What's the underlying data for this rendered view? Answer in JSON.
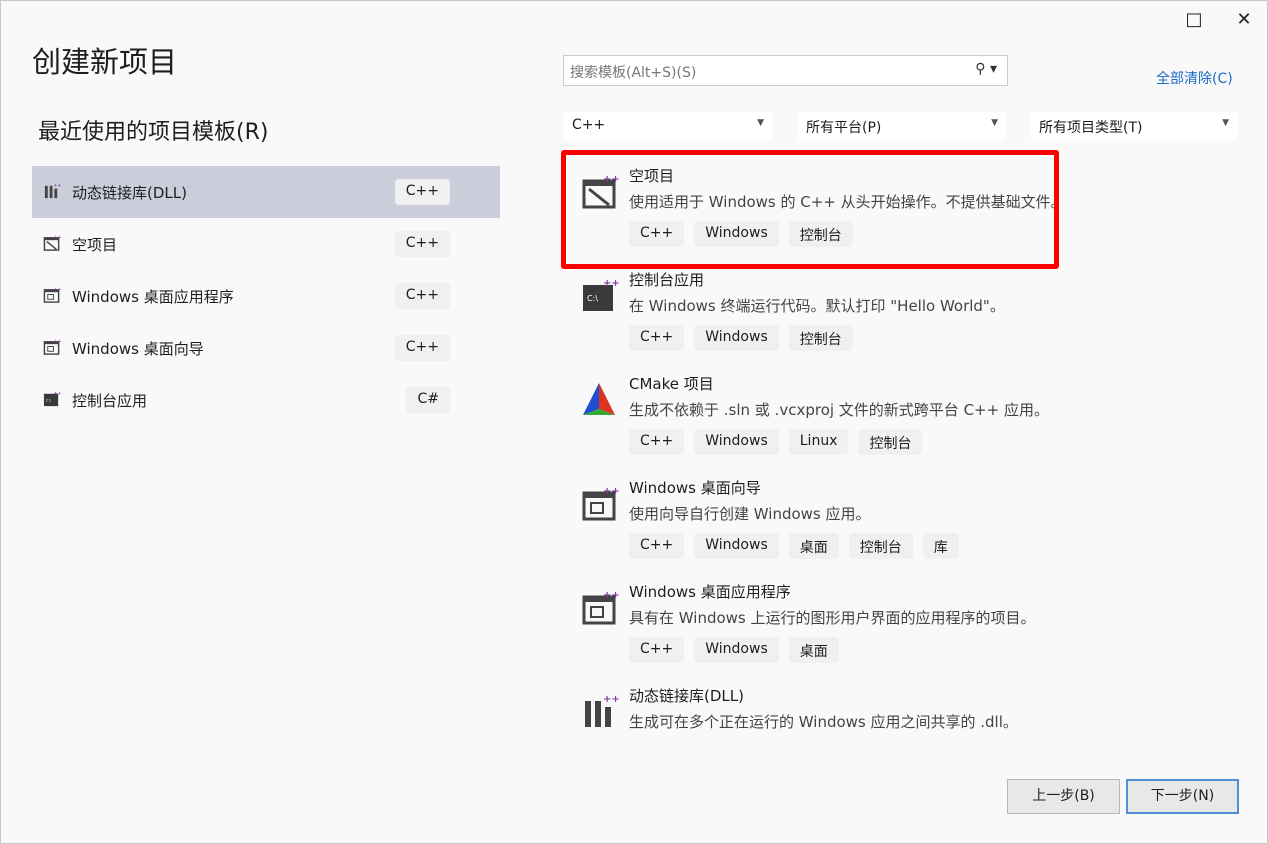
{
  "window": {
    "maximize_icon": "□",
    "close_icon": "✕"
  },
  "title": "创建新项目",
  "recent_heading": "最近使用的项目模板(R)",
  "search": {
    "placeholder": "搜索模板(Alt+S)(S)"
  },
  "clear_all": "全部清除(C)",
  "filters": {
    "language": "C++",
    "platform": "所有平台(P)",
    "project_type": "所有项目类型(T)"
  },
  "recent": [
    {
      "label": "动态链接库(DLL)",
      "tag": "C++",
      "selected": true
    },
    {
      "label": "空项目",
      "tag": "C++"
    },
    {
      "label": "Windows 桌面应用程序",
      "tag": "C++"
    },
    {
      "label": "Windows 桌面向导",
      "tag": "C++"
    },
    {
      "label": "控制台应用",
      "tag": "C#"
    }
  ],
  "templates": [
    {
      "title": "空项目",
      "desc": "使用适用于 Windows 的 C++ 从头开始操作。不提供基础文件。",
      "tags": [
        "C++",
        "Windows",
        "控制台"
      ]
    },
    {
      "title": "控制台应用",
      "desc": "在 Windows 终端运行代码。默认打印 \"Hello World\"。",
      "tags": [
        "C++",
        "Windows",
        "控制台"
      ]
    },
    {
      "title": "CMake 项目",
      "desc": "生成不依赖于 .sln 或 .vcxproj 文件的新式跨平台 C++ 应用。",
      "tags": [
        "C++",
        "Windows",
        "Linux",
        "控制台"
      ]
    },
    {
      "title": "Windows 桌面向导",
      "desc": "使用向导自行创建 Windows 应用。",
      "tags": [
        "C++",
        "Windows",
        "桌面",
        "控制台",
        "库"
      ]
    },
    {
      "title": "Windows 桌面应用程序",
      "desc": "具有在 Windows 上运行的图形用户界面的应用程序的项目。",
      "tags": [
        "C++",
        "Windows",
        "桌面"
      ]
    },
    {
      "title": "动态链接库(DLL)",
      "desc": "生成可在多个正在运行的 Windows 应用之间共享的 .dll。",
      "tags": []
    }
  ],
  "buttons": {
    "back": "上一步(B)",
    "next": "下一步(N)"
  }
}
